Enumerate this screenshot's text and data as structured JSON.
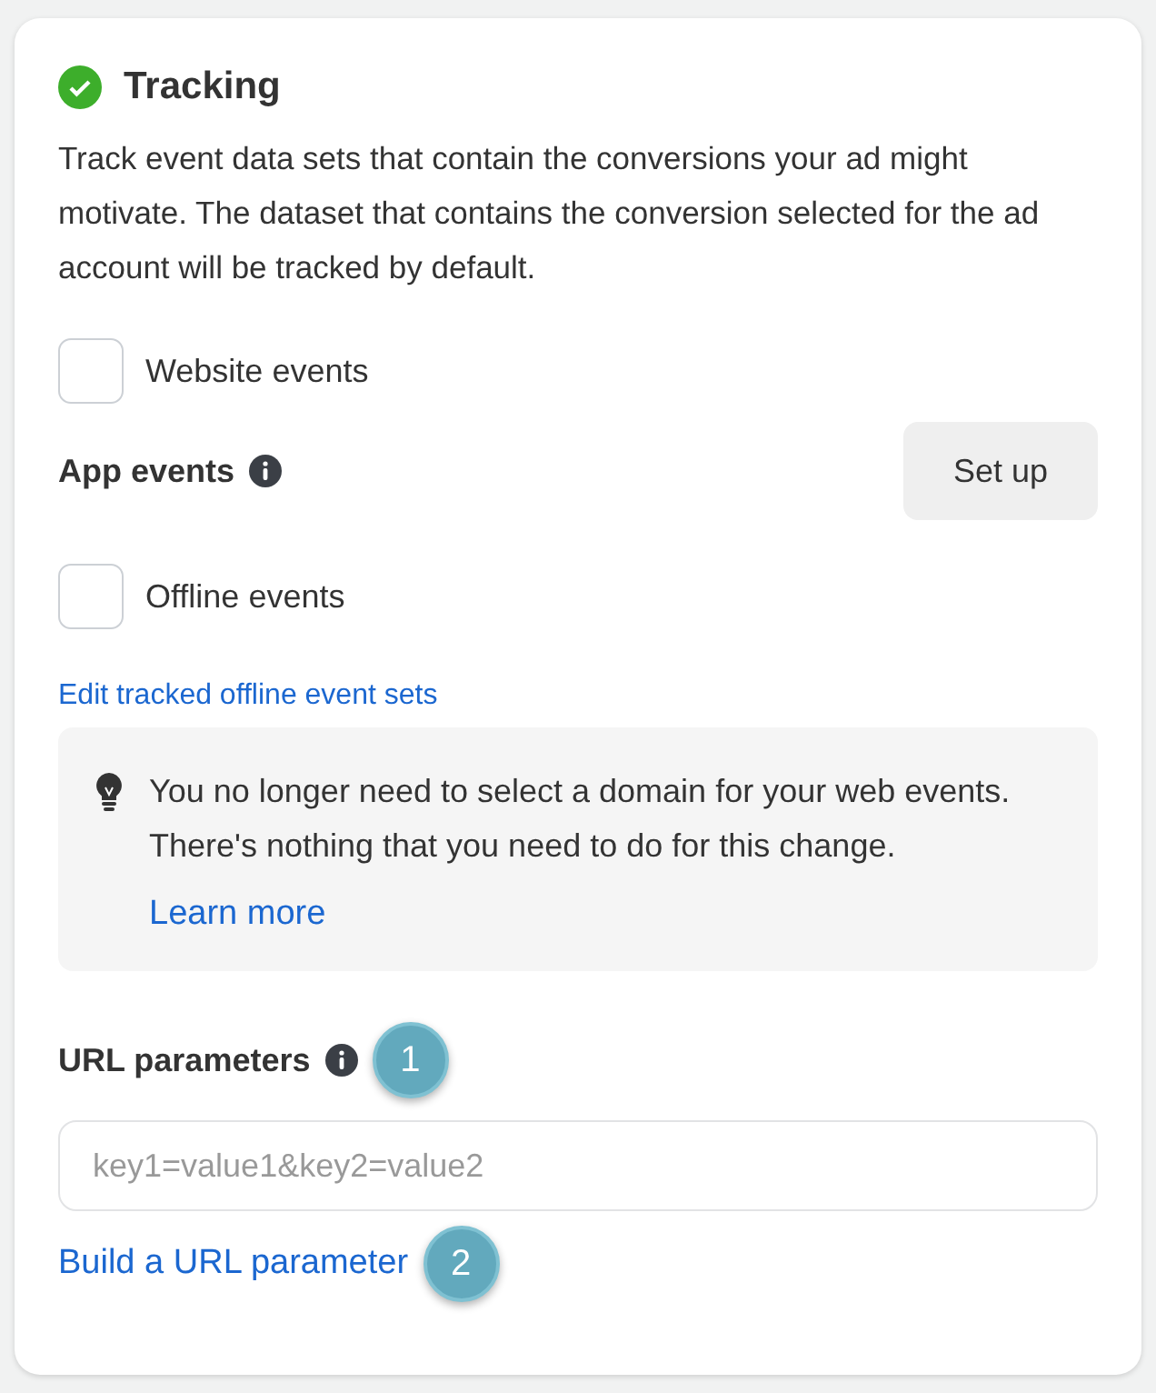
{
  "section": {
    "title": "Tracking",
    "complete": true,
    "description": "Track event data sets that contain the conversions your ad might motivate. The dataset that contains the conversion selected for the ad account will be tracked by default."
  },
  "events": [
    {
      "kind": "checkbox",
      "label": "Website events",
      "checked": false
    },
    {
      "kind": "setup",
      "label": "App events",
      "button": "Set up"
    },
    {
      "kind": "checkbox",
      "label": "Offline events",
      "checked": false
    }
  ],
  "edit_link": "Edit tracked offline event sets",
  "tip": {
    "text": "You no longer need to select a domain for your web events. There's nothing that you need to do for this change.",
    "link": "Learn more"
  },
  "url_parameters": {
    "label": "URL parameters",
    "marker": "1",
    "placeholder": "key1=value1&key2=value2",
    "link": "Build a URL parameter",
    "link_marker": "2"
  }
}
